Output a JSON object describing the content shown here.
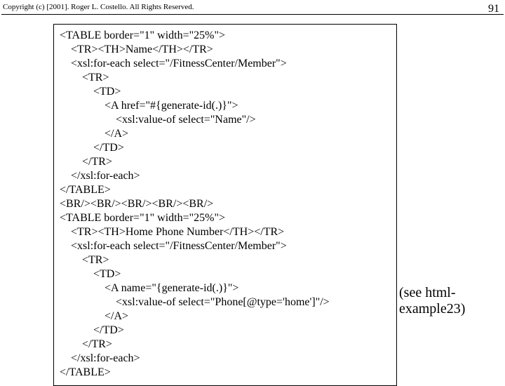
{
  "header": {
    "copyright": "Copyright (c) [2001].  Roger L. Costello.  All Rights Reserved.",
    "page_number": "91"
  },
  "code": {
    "l1": "<TABLE border=\"1\" width=\"25%\">",
    "l2": "    <TR><TH>Name</TH></TR>",
    "l3": "    <xsl:for-each select=\"/FitnessCenter/Member\">",
    "l4": "        <TR>",
    "l5": "            <TD>",
    "l6": "                <A href=\"#{generate-id(.)}\">",
    "l7": "                    <xsl:value-of select=\"Name\"/>",
    "l8": "                </A>",
    "l9": "            </TD>",
    "l10": "        </TR>",
    "l11": "    </xsl:for-each>",
    "l12": "</TABLE>",
    "l13": "<BR/><BR/><BR/><BR/><BR/>",
    "l14": "<TABLE border=\"1\" width=\"25%\">",
    "l15": "    <TR><TH>Home Phone Number</TH></TR>",
    "l16": "    <xsl:for-each select=\"/FitnessCenter/Member\">",
    "l17": "        <TR>",
    "l18": "            <TD>",
    "l19": "                <A name=\"{generate-id(.)}\">",
    "l20": "                    <xsl:value-of select=\"Phone[@type='home']\"/>",
    "l21": "                </A>",
    "l22": "            </TD>",
    "l23": "        </TR>",
    "l24": "    </xsl:for-each>",
    "l25": "</TABLE>"
  },
  "annotation": "(see html-example23)"
}
